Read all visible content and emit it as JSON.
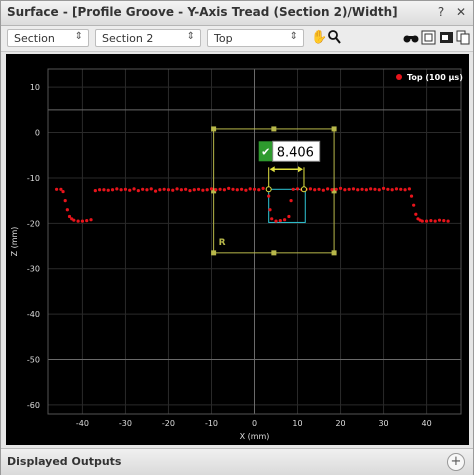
{
  "window": {
    "title": "Surface - [Profile Groove - Y-Axis Tread (Section 2)/Width]",
    "help_icon": "?",
    "close_icon": "✕"
  },
  "toolbar": {
    "dropdowns": [
      {
        "id": "source",
        "value": "Section"
      },
      {
        "id": "section",
        "value": "Section 2"
      },
      {
        "id": "view",
        "value": "Top"
      }
    ],
    "tools": [
      "hand-pan-icon",
      "zoom-icon",
      "binoculars-icon",
      "fit-view-icon",
      "snapshot-icon",
      "copy-icon"
    ]
  },
  "chart_data": {
    "type": "scatter",
    "title": "",
    "xlabel": "X (mm)",
    "ylabel": "Z (mm)",
    "xlim": [
      -48,
      48
    ],
    "ylim": [
      -62,
      14
    ],
    "xticks": [
      -40,
      -30,
      -20,
      -10,
      0,
      10,
      20,
      30,
      40
    ],
    "yticks": [
      10,
      0,
      -10,
      -20,
      -30,
      -40,
      -50,
      -60
    ],
    "grid": true,
    "legend": {
      "position": "top-right",
      "entries": [
        {
          "name": "Top (100 µs)",
          "color": "#e8141b"
        }
      ]
    },
    "series": [
      {
        "name": "Top (100 µs)",
        "color": "#e8141b",
        "x": [
          -46,
          -45,
          -44.5,
          -44,
          -43.5,
          -43,
          -42.5,
          -42,
          -41,
          -40,
          -39,
          -38,
          -37,
          -36,
          -35,
          -34,
          -33,
          -32,
          -31,
          -30,
          -29,
          -28,
          -27,
          -26,
          -25,
          -24,
          -23,
          -22,
          -21,
          -20,
          -19,
          -18,
          -17,
          -16,
          -15,
          -14,
          -13,
          -12,
          -11,
          -10,
          -9,
          -8,
          -7,
          -6,
          -5,
          -4,
          -3,
          -2,
          -1,
          0,
          1,
          2,
          3,
          3.3,
          3.6,
          4,
          5,
          6,
          7,
          8,
          8.5,
          9,
          10,
          11,
          11.5,
          12,
          13,
          14,
          15,
          16,
          17,
          18,
          19,
          20,
          21,
          22,
          23,
          24,
          25,
          26,
          27,
          28,
          29,
          30,
          31,
          32,
          33,
          34,
          35,
          36,
          36.5,
          37,
          37.5,
          38,
          38.5,
          39,
          40,
          41,
          42,
          43,
          44,
          45
        ],
        "y": [
          -12.5,
          -12.5,
          -13,
          -15,
          -17,
          -18.5,
          -19,
          -19.3,
          -19.5,
          -19.5,
          -19.4,
          -19.2,
          -12.8,
          -12.6,
          -12.6,
          -12.7,
          -12.6,
          -12.4,
          -12.6,
          -12.5,
          -12.7,
          -12.4,
          -12.8,
          -12.5,
          -12.6,
          -12.4,
          -12.9,
          -12.6,
          -12.5,
          -12.6,
          -12.7,
          -12.4,
          -12.6,
          -12.5,
          -12.8,
          -12.6,
          -12.5,
          -12.7,
          -12.6,
          -12.4,
          -12.6,
          -12.5,
          -12.6,
          -12.3,
          -12.5,
          -12.6,
          -12.5,
          -12.7,
          -12.4,
          -12.5,
          -12.6,
          -12.3,
          -12.5,
          -14,
          -17,
          -19,
          -19.5,
          -19.4,
          -19.2,
          -18.5,
          -15,
          -12.5,
          -12.4,
          -12.6,
          -12.3,
          -12.5,
          -12.4,
          -12.6,
          -12.5,
          -12.7,
          -12.4,
          -12.6,
          -12.5,
          -12.3,
          -12.6,
          -12.5,
          -12.4,
          -12.6,
          -12.5,
          -12.6,
          -12.4,
          -12.5,
          -12.6,
          -12.3,
          -12.5,
          -12.6,
          -12.4,
          -12.5,
          -12.6,
          -12.4,
          -14,
          -16,
          -18,
          -19,
          -19.3,
          -19.5,
          -19.5,
          -19.4,
          -19.5,
          -19.3,
          -19.4,
          -19.5
        ]
      }
    ],
    "annotations": {
      "measurement_value": "8.406",
      "region_label": "R",
      "region_box": {
        "x1": -9.5,
        "x2": 18.5,
        "y1": 0.8,
        "y2": -26.5
      },
      "measure_markers": {
        "x1": 3.3,
        "x2": 11.5,
        "y": -12.5
      },
      "groove_box": {
        "x1": 3.3,
        "x2": 11.8,
        "y1": -12.5,
        "y2": -19.8
      }
    }
  },
  "bottom_panel": {
    "label": "Displayed Outputs",
    "add_icon": "+"
  }
}
